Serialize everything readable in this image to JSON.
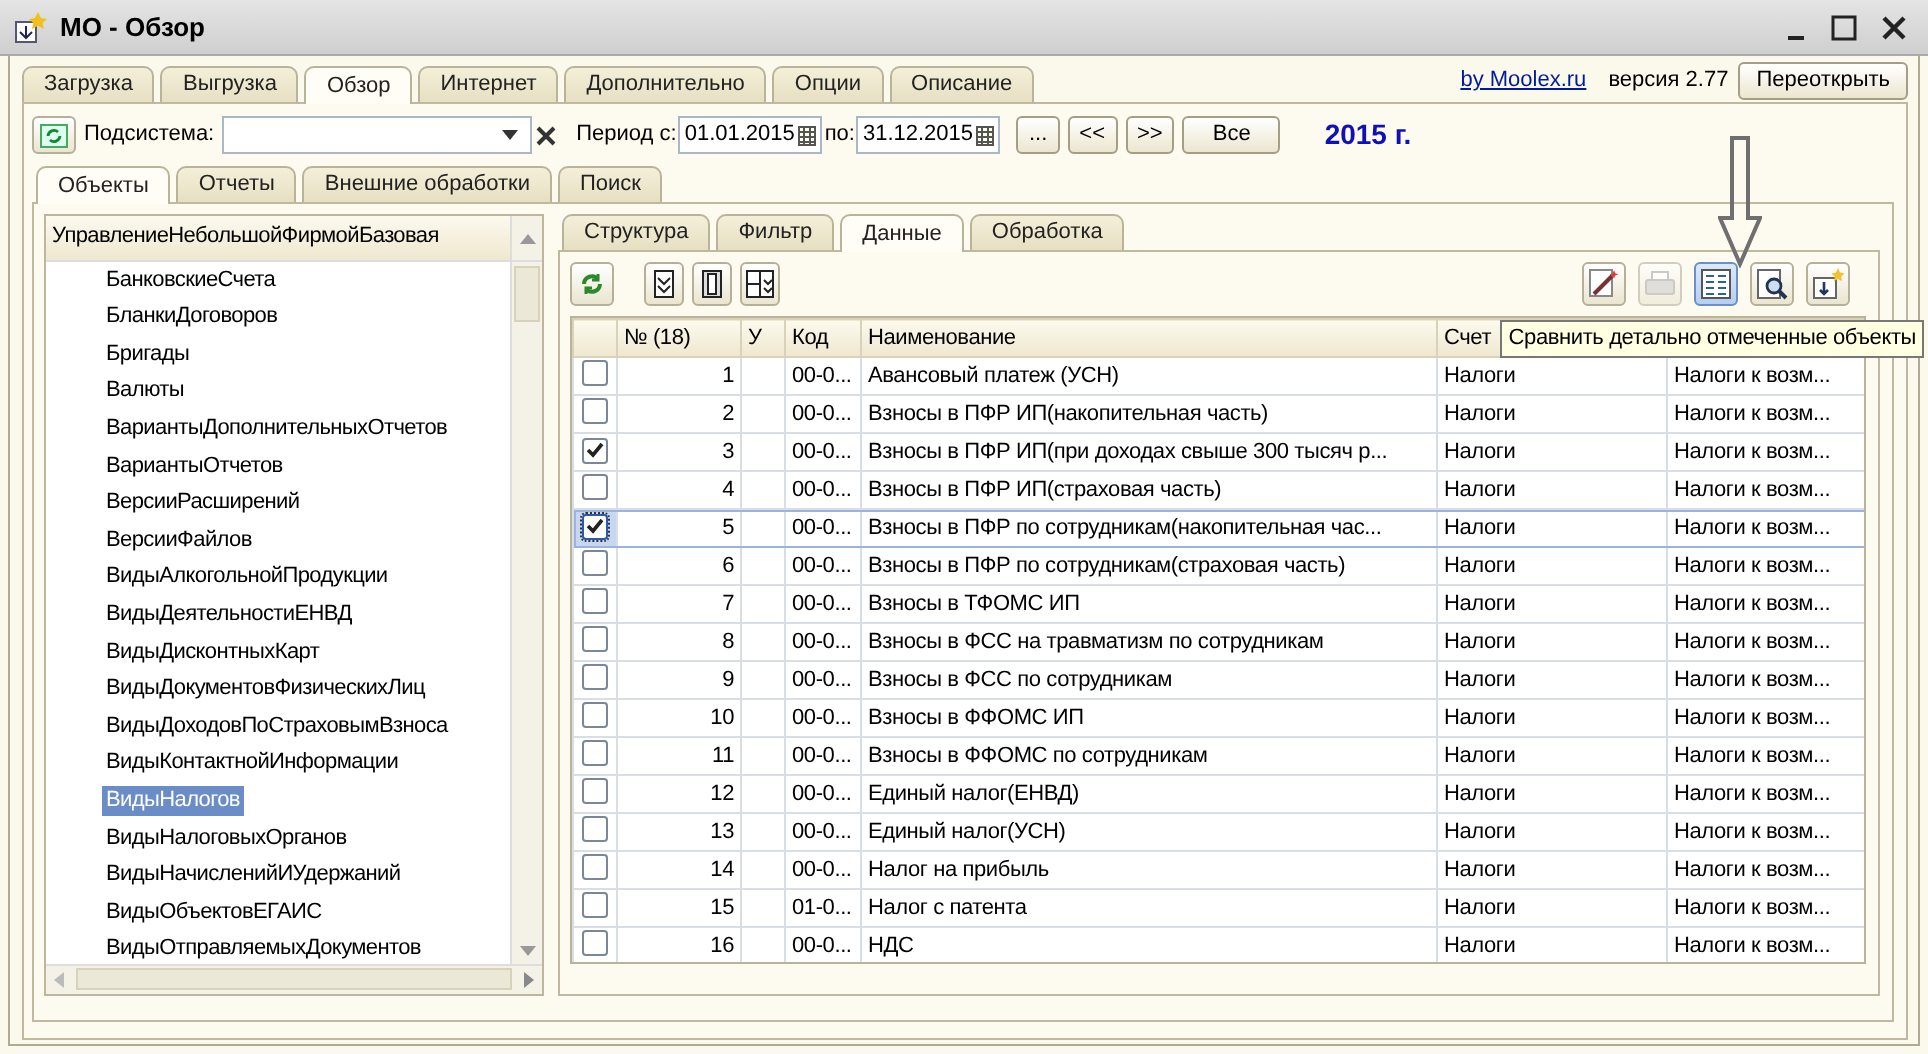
{
  "window": {
    "title": "МО - Обзор"
  },
  "top_tabs": [
    {
      "label": "Загрузка",
      "selected": false
    },
    {
      "label": "Выгрузка",
      "selected": false
    },
    {
      "label": "Обзор",
      "selected": true
    },
    {
      "label": "Интернет",
      "selected": false
    },
    {
      "label": "Дополнительно",
      "selected": false
    },
    {
      "label": "Опции",
      "selected": false
    },
    {
      "label": "Описание",
      "selected": false
    }
  ],
  "header": {
    "link": "by Moolex.ru",
    "version": "версия 2.77",
    "reopen_button": "Переоткрыть"
  },
  "filter": {
    "subsystem_label": "Подсистема:",
    "period_label": "Период с:",
    "date_from": "01.01.2015",
    "to_label": "по:",
    "date_to": "31.12.2015",
    "buttons": [
      "...",
      "<<",
      ">>",
      "Все"
    ],
    "year": "2015 г."
  },
  "sub_tabs": [
    {
      "label": "Объекты",
      "selected": true
    },
    {
      "label": "Отчеты",
      "selected": false
    },
    {
      "label": "Внешние обработки",
      "selected": false
    },
    {
      "label": "Поиск",
      "selected": false
    }
  ],
  "tree": {
    "header": "УправлениеНебольшойФирмойБазовая",
    "items": [
      {
        "label": "БанковскиеСчета",
        "selected": false
      },
      {
        "label": "БланкиДоговоров",
        "selected": false
      },
      {
        "label": "Бригады",
        "selected": false
      },
      {
        "label": "Валюты",
        "selected": false
      },
      {
        "label": "ВариантыДополнительныхОтчетов",
        "selected": false
      },
      {
        "label": "ВариантыОтчетов",
        "selected": false
      },
      {
        "label": "ВерсииРасширений",
        "selected": false
      },
      {
        "label": "ВерсииФайлов",
        "selected": false
      },
      {
        "label": "ВидыАлкогольнойПродукции",
        "selected": false
      },
      {
        "label": "ВидыДеятельностиЕНВД",
        "selected": false
      },
      {
        "label": "ВидыДисконтныхКарт",
        "selected": false
      },
      {
        "label": "ВидыДокументовФизическихЛиц",
        "selected": false
      },
      {
        "label": "ВидыДоходовПоСтраховымВзноса",
        "selected": false
      },
      {
        "label": "ВидыКонтактнойИнформации",
        "selected": false
      },
      {
        "label": "ВидыНалогов",
        "selected": true
      },
      {
        "label": "ВидыНалоговыхОрганов",
        "selected": false
      },
      {
        "label": "ВидыНачисленийИУдержаний",
        "selected": false
      },
      {
        "label": "ВидыОбъектовЕГАИС",
        "selected": false
      },
      {
        "label": "ВидыОтправляемыхДокументов",
        "selected": false
      }
    ]
  },
  "data_tabs": [
    {
      "label": "Структура",
      "selected": false
    },
    {
      "label": "Фильтр",
      "selected": false
    },
    {
      "label": "Данные",
      "selected": true
    },
    {
      "label": "Обработка",
      "selected": false
    }
  ],
  "tooltip": "Сравнить детально отмеченные объекты",
  "table": {
    "columns": [
      "№ (18)",
      "У",
      "Код",
      "Наименование",
      "Счет"
    ],
    "rows": [
      {
        "checked": false,
        "selected": false,
        "number": "1",
        "code": "00-0...",
        "name": "Авансовый платеж (УСН)",
        "account": "Налоги",
        "column_7": "Налоги к возм..."
      },
      {
        "checked": false,
        "selected": false,
        "number": "2",
        "code": "00-0...",
        "name": "Взносы в ПФР ИП(накопительная часть)",
        "account": "Налоги",
        "column_7": "Налоги к возм..."
      },
      {
        "checked": true,
        "selected": false,
        "number": "3",
        "code": "00-0...",
        "name": "Взносы в ПФР ИП(при доходах свыше 300 тысяч р...",
        "account": "Налоги",
        "column_7": "Налоги к возм..."
      },
      {
        "checked": false,
        "selected": false,
        "number": "4",
        "code": "00-0...",
        "name": "Взносы в ПФР ИП(страховая часть)",
        "account": "Налоги",
        "column_7": "Налоги к возм..."
      },
      {
        "checked": true,
        "selected": true,
        "number": "5",
        "code": "00-0...",
        "name": "Взносы в ПФР по сотрудникам(накопительная час...",
        "account": "Налоги",
        "column_7": "Налоги к возм..."
      },
      {
        "checked": false,
        "selected": false,
        "number": "6",
        "code": "00-0...",
        "name": "Взносы в ПФР по сотрудникам(страховая часть)",
        "account": "Налоги",
        "column_7": "Налоги к возм..."
      },
      {
        "checked": false,
        "selected": false,
        "number": "7",
        "code": "00-0...",
        "name": "Взносы в ТФОМС ИП",
        "account": "Налоги",
        "column_7": "Налоги к возм..."
      },
      {
        "checked": false,
        "selected": false,
        "number": "8",
        "code": "00-0...",
        "name": "Взносы в ФСС на травматизм по сотрудникам",
        "account": "Налоги",
        "column_7": "Налоги к возм..."
      },
      {
        "checked": false,
        "selected": false,
        "number": "9",
        "code": "00-0...",
        "name": "Взносы в ФСС по сотрудникам",
        "account": "Налоги",
        "column_7": "Налоги к возм..."
      },
      {
        "checked": false,
        "selected": false,
        "number": "10",
        "code": "00-0...",
        "name": "Взносы в ФФОМС ИП",
        "account": "Налоги",
        "column_7": "Налоги к возм..."
      },
      {
        "checked": false,
        "selected": false,
        "number": "11",
        "code": "00-0...",
        "name": "Взносы в ФФОМС по сотрудникам",
        "account": "Налоги",
        "column_7": "Налоги к возм..."
      },
      {
        "checked": false,
        "selected": false,
        "number": "12",
        "code": "00-0...",
        "name": "Единый налог(ЕНВД)",
        "account": "Налоги",
        "column_7": "Налоги к возм..."
      },
      {
        "checked": false,
        "selected": false,
        "number": "13",
        "code": "00-0...",
        "name": "Единый налог(УСН)",
        "account": "Налоги",
        "column_7": "Налоги к возм..."
      },
      {
        "checked": false,
        "selected": false,
        "number": "14",
        "code": "00-0...",
        "name": "Налог на прибыль",
        "account": "Налоги",
        "column_7": "Налоги к возм..."
      },
      {
        "checked": false,
        "selected": false,
        "number": "15",
        "code": "01-0...",
        "name": "Налог с патента",
        "account": "Налоги",
        "column_7": "Налоги к возм..."
      },
      {
        "checked": false,
        "selected": false,
        "number": "16",
        "code": "00-0...",
        "name": "НДС",
        "account": "Налоги",
        "column_7": "Налоги к возм..."
      }
    ]
  }
}
